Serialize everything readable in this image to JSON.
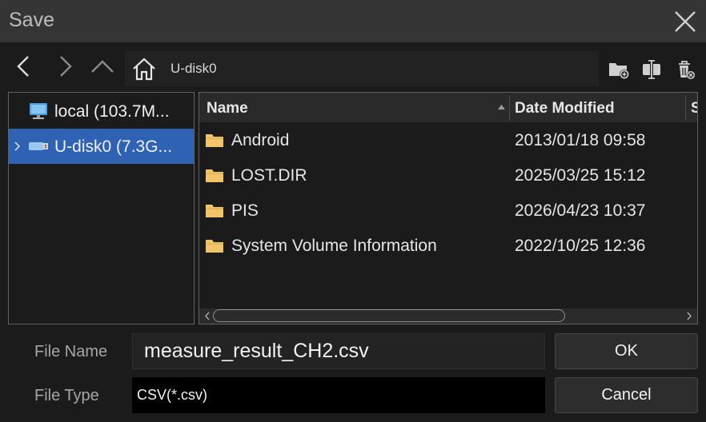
{
  "dialog": {
    "title": "Save"
  },
  "address": {
    "path": "U-disk0"
  },
  "tree": {
    "items": [
      {
        "label": "local  (103.7M...",
        "selected": false
      },
      {
        "label": "U-disk0  (7.3G...",
        "selected": true
      }
    ]
  },
  "list": {
    "columns": [
      "Name",
      "Date Modified",
      "S"
    ],
    "rows": [
      {
        "name": "Android",
        "date": "2013/01/18 09:58"
      },
      {
        "name": "LOST.DIR",
        "date": "2025/03/25 15:12"
      },
      {
        "name": "PIS",
        "date": "2026/04/23 10:37"
      },
      {
        "name": "System Volume Information",
        "date": "2022/10/25 12:36"
      }
    ]
  },
  "form": {
    "file_name_label": "File Name",
    "file_name_value": "measure_result_CH2.csv",
    "file_type_label": "File Type",
    "file_type_value": "CSV(*.csv)",
    "ok_label": "OK",
    "cancel_label": "Cancel"
  },
  "colors": {
    "selection": "#2f62b3",
    "folder": "#f2c46a",
    "background": "#1b1b1b"
  }
}
